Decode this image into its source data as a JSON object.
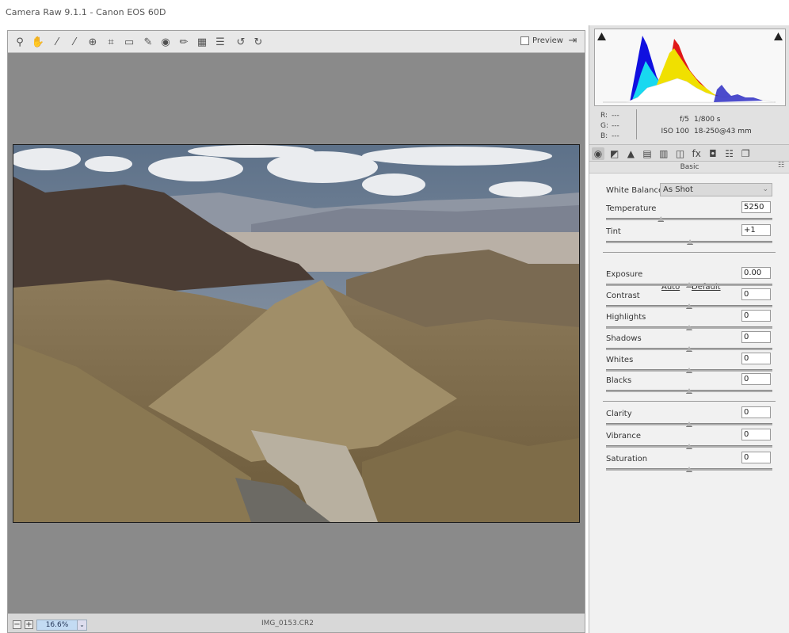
{
  "window": {
    "title": "Camera Raw 9.1.1  -  Canon EOS 60D"
  },
  "toolbar": {
    "tools": [
      {
        "name": "zoom-tool-icon",
        "glyph": "⚲"
      },
      {
        "name": "hand-tool-icon",
        "glyph": "✋"
      },
      {
        "name": "white-balance-tool-icon",
        "glyph": "⁄"
      },
      {
        "name": "color-sampler-tool-icon",
        "glyph": "⁄"
      },
      {
        "name": "targeted-adjustment-tool-icon",
        "glyph": "⊕"
      },
      {
        "name": "crop-tool-icon",
        "glyph": "⌗"
      },
      {
        "name": "straighten-tool-icon",
        "glyph": "▭"
      },
      {
        "name": "spot-removal-tool-icon",
        "glyph": "✎"
      },
      {
        "name": "red-eye-removal-icon",
        "glyph": "◉"
      },
      {
        "name": "adjustment-brush-icon",
        "glyph": "✏"
      },
      {
        "name": "graduated-filter-icon",
        "glyph": "▦"
      },
      {
        "name": "radial-filter-icon",
        "glyph": "☰"
      },
      {
        "name": "rotate-ccw-icon",
        "glyph": "↺"
      },
      {
        "name": "rotate-cw-icon",
        "glyph": "↻"
      }
    ],
    "preview_label": "Preview",
    "fullscreen_glyph": "⇥"
  },
  "statusbar": {
    "zoom_out": "−",
    "zoom_in": "+",
    "zoom_value": "16.6%",
    "zoom_dropdown": "⌄",
    "filename": "IMG_0153.CR2"
  },
  "readout": {
    "r_label": "R:",
    "r_value": "---",
    "g_label": "G:",
    "g_value": "---",
    "b_label": "B:",
    "b_value": "---",
    "aperture": "f/5",
    "shutter": "1/800 s",
    "iso": "ISO 100",
    "lens": "18-250@43 mm"
  },
  "tabs": [
    {
      "name": "tab-basic-icon",
      "glyph": "◉",
      "active": true
    },
    {
      "name": "tab-tone-curve-icon",
      "glyph": "◩",
      "active": false
    },
    {
      "name": "tab-detail-icon",
      "glyph": "▲",
      "active": false
    },
    {
      "name": "tab-hsl-icon",
      "glyph": "▤",
      "active": false
    },
    {
      "name": "tab-split-toning-icon",
      "glyph": "▥",
      "active": false
    },
    {
      "name": "tab-lens-corrections-icon",
      "glyph": "◫",
      "active": false
    },
    {
      "name": "tab-effects-icon",
      "glyph": "fx",
      "active": false
    },
    {
      "name": "tab-camera-calibration-icon",
      "glyph": "◘",
      "active": false
    },
    {
      "name": "tab-presets-icon",
      "glyph": "☷",
      "active": false
    },
    {
      "name": "tab-snapshots-icon",
      "glyph": "❐",
      "active": false
    }
  ],
  "panel": {
    "title": "Basic",
    "menu_glyph": "☷",
    "white_balance_label": "White Balance:",
    "white_balance_value": "As Shot",
    "auto_link": "Auto",
    "default_link": "Default",
    "sliders": [
      {
        "label": "Temperature",
        "value": "5250",
        "pos": 0.33
      },
      {
        "label": "Tint",
        "value": "+1",
        "pos": 0.505
      },
      {
        "label": "Exposure",
        "value": "0.00",
        "pos": 0.5
      },
      {
        "label": "Contrast",
        "value": "0",
        "pos": 0.5
      },
      {
        "label": "Highlights",
        "value": "0",
        "pos": 0.5
      },
      {
        "label": "Shadows",
        "value": "0",
        "pos": 0.5
      },
      {
        "label": "Whites",
        "value": "0",
        "pos": 0.5
      },
      {
        "label": "Blacks",
        "value": "0",
        "pos": 0.5
      },
      {
        "label": "Clarity",
        "value": "0",
        "pos": 0.5
      },
      {
        "label": "Vibrance",
        "value": "0",
        "pos": 0.5
      },
      {
        "label": "Saturation",
        "value": "0",
        "pos": 0.5
      }
    ]
  },
  "colors": {
    "accent": "#c3dbf3",
    "histogram_blue": "#1010e0",
    "histogram_red": "#e01818",
    "histogram_yellow": "#f0e000",
    "histogram_cyan": "#18d8f0"
  }
}
